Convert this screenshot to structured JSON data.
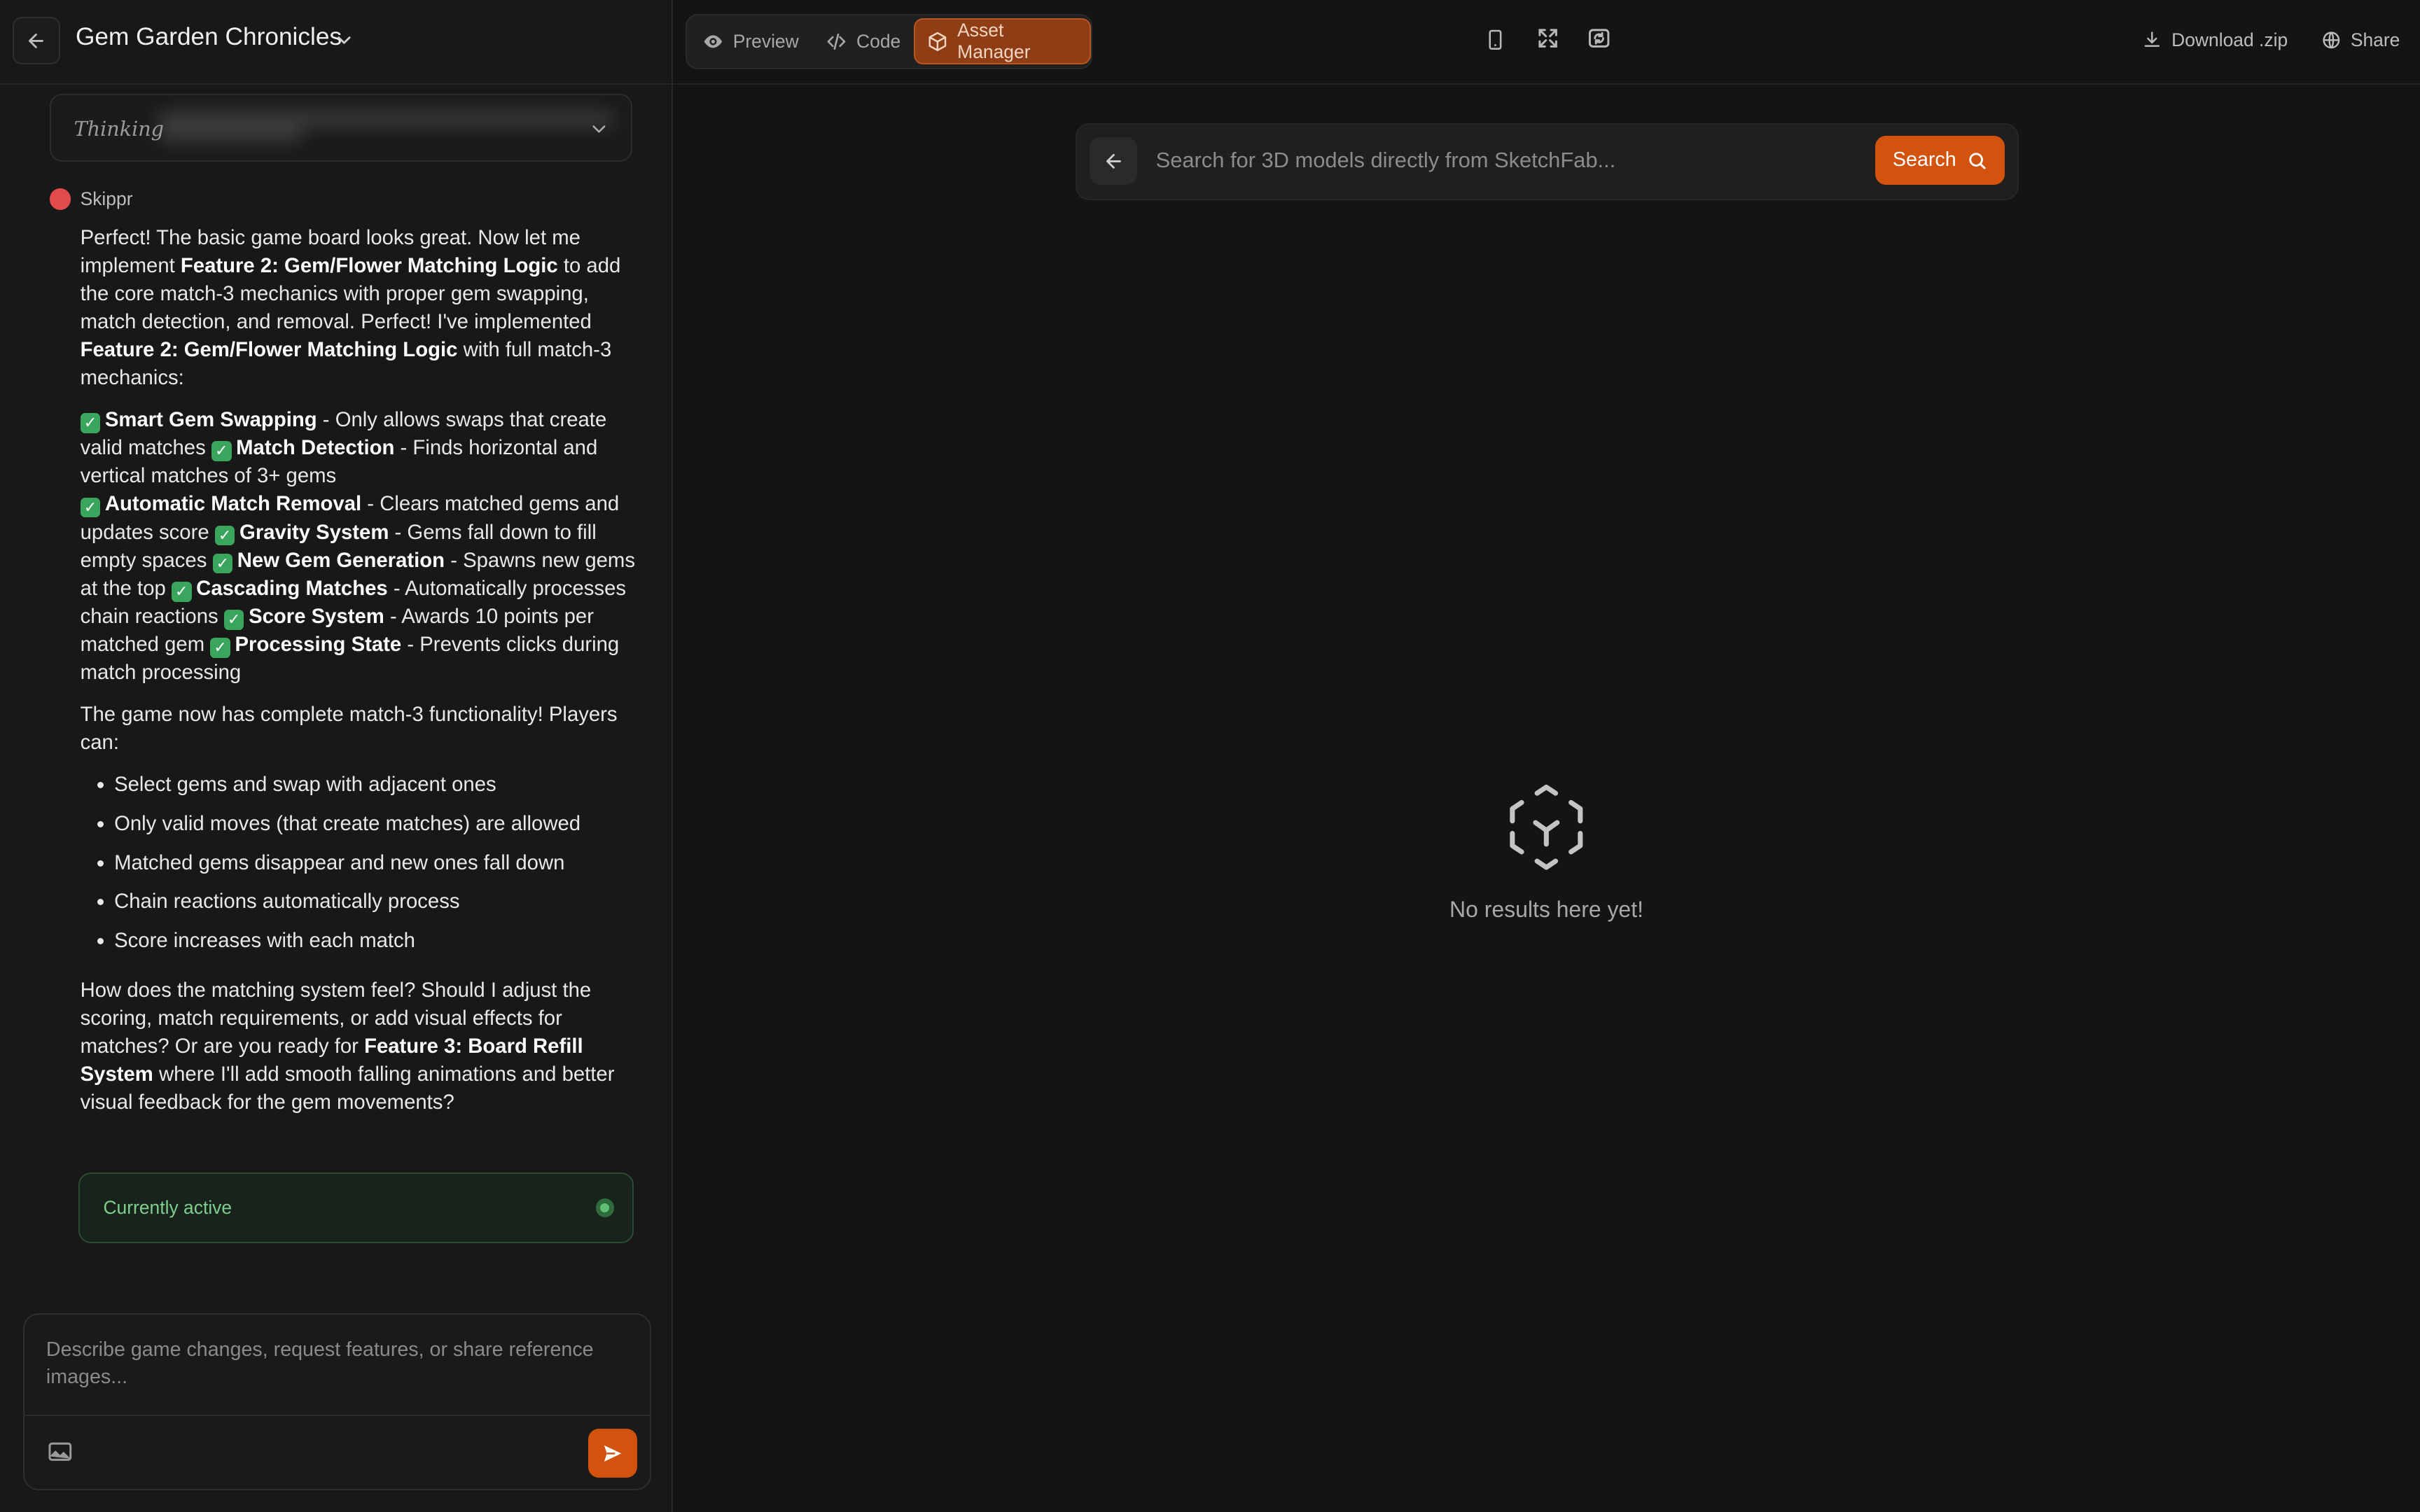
{
  "header": {
    "project_title": "Gem Garden Chronicles"
  },
  "thinking": {
    "label": "Thinking"
  },
  "agent": {
    "name": "Skippr"
  },
  "message": {
    "para1": {
      "t1": "Perfect! The basic game board looks great. Now let me implement ",
      "b1": "Feature 2: Gem/Flower Matching Logic",
      "t2": " to add the core match-3 mechanics with proper gem swapping, match detection, and removal. Perfect! I've implemented ",
      "b2": "Feature 2: Gem/Flower Matching Logic",
      "t3": " with full match-3 mechanics:"
    },
    "features": [
      {
        "title": "Smart Gem Swapping",
        "desc": " - Only allows swaps that create valid matches "
      },
      {
        "title": "Match Detection",
        "desc": " - Finds horizontal and vertical matches of 3+ gems"
      },
      {
        "title": "Automatic Match Removal",
        "desc": " - Clears matched gems and updates score "
      },
      {
        "title": "Gravity System",
        "desc": " - Gems fall down to fill empty spaces "
      },
      {
        "title": "New Gem Generation",
        "desc": " - Spawns new gems at the top "
      },
      {
        "title": "Cascading Matches",
        "desc": " - Automatically processes chain reactions "
      },
      {
        "title": "Score System",
        "desc": " - Awards 10 points per matched gem "
      },
      {
        "title": "Processing State",
        "desc": " - Prevents clicks during match processing"
      }
    ],
    "para2": "The game now has complete match-3 functionality! Players can:",
    "bullets": [
      "Select gems and swap with adjacent ones",
      "Only valid moves (that create matches) are allowed",
      "Matched gems disappear and new ones fall down",
      "Chain reactions automatically process",
      "Score increases with each match"
    ],
    "para3": {
      "t1": "How does the matching system feel? Should I adjust the scoring, match requirements, or add visual effects for matches? Or are you ready for ",
      "b1": "Feature 3: Board Refill System",
      "t2": " where I'll add smooth falling animations and better visual feedback for the gem movements?"
    }
  },
  "status_card": {
    "label": "Currently active"
  },
  "composer": {
    "placeholder": "Describe game changes, request features, or share reference images..."
  },
  "toolbar": {
    "tabs": [
      {
        "label": "Preview"
      },
      {
        "label": "Code"
      },
      {
        "label": "Asset Manager",
        "active": true
      }
    ],
    "download_label": "Download .zip",
    "share_label": "Share"
  },
  "asset_search": {
    "placeholder": "Search for 3D models directly from SketchFab...",
    "button_label": "Search",
    "empty_text": "No results here yet!"
  },
  "colors": {
    "accent": "#d2520f",
    "active_tab_bg": "#8e3d14",
    "status_green": "#5fbf74",
    "agent_dot": "#e24b4b"
  }
}
